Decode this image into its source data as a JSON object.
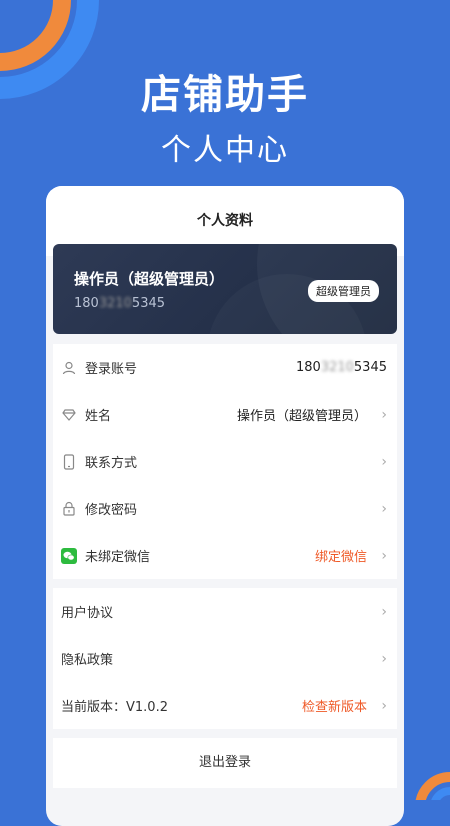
{
  "hero": {
    "title": "店铺助手",
    "subtitle": "个人中心"
  },
  "page": {
    "title": "个人资料"
  },
  "profile": {
    "name": "操作员（超级管理员）",
    "phone_prefix": "180",
    "phone_masked": "3210",
    "phone_suffix": "5345",
    "role_badge": "超级管理员"
  },
  "info_rows": [
    {
      "label": "登录账号",
      "value_prefix": "180",
      "value_masked": "3210",
      "value_suffix": "5345"
    },
    {
      "label": "姓名",
      "value": "操作员（超级管理员）"
    },
    {
      "label": "联系方式",
      "value": ""
    },
    {
      "label": "修改密码",
      "value": ""
    },
    {
      "label": "未绑定微信",
      "value": "绑定微信"
    }
  ],
  "settings_rows": [
    {
      "label": "用户协议"
    },
    {
      "label": "隐私政策"
    },
    {
      "label": "当前版本：V1.0.2",
      "value": "检查新版本"
    }
  ],
  "logout_label": "退出登录",
  "colors": {
    "background": "#3a72d6",
    "accent": "#ef5a28",
    "card": "#243049",
    "deco_orange": "#f08a3c"
  }
}
